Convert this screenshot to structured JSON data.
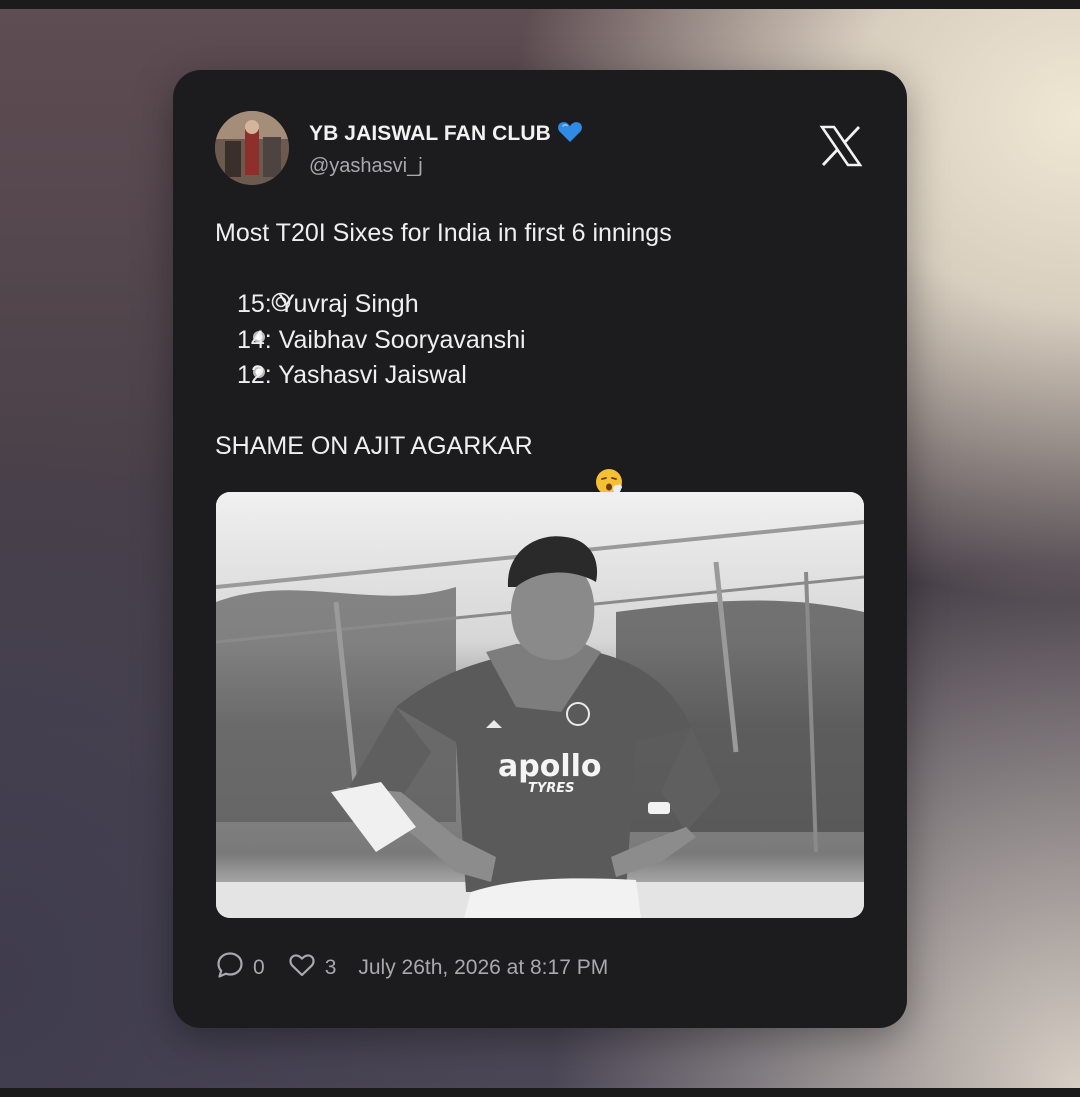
{
  "account": {
    "name": "YB JAISWAL FAN CLUB",
    "handle": "@yashasvi_j",
    "verified_icon": "blue-heart-icon",
    "platform_icon": "x-logo-icon"
  },
  "tweet": {
    "headline": "Most T20I Sixes for India in first 6 innings",
    "items": [
      {
        "marker": "◎",
        "text": "15: Yuvraj Singh"
      },
      {
        "marker": "●",
        "text": "14: Vaibhav Sooryavanshi"
      },
      {
        "marker": "●",
        "text": "12: Yashasvi Jaiswal"
      }
    ],
    "closing": "SHAME ON AJIT AGARKAR",
    "closing_emoji": "tired-face-emoji",
    "photo": {
      "jersey_brand": "apollo",
      "jersey_sub": "TYRES"
    }
  },
  "footer": {
    "replies": "0",
    "likes": "3",
    "timestamp": "July 26th, 2026 at 8:17 PM"
  },
  "colors": {
    "card": "#1c1b1d",
    "text": "#efefef",
    "muted": "#a9a9ad",
    "verified": "#2f8be6"
  }
}
